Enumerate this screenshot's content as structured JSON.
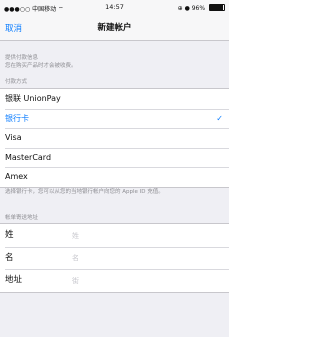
{
  "status_bar": {
    "carrier": "●●●○○ 中国移动 ⌔",
    "time": "14:57",
    "right_icons": "⊕ ●",
    "battery_text": "96%",
    "battery_level": 0.96
  },
  "nav": {
    "cancel_label": "取消",
    "title": "新建帐户"
  },
  "payment_info_note": {
    "line1": "提供付款信息",
    "line2": "您在购买产品时才会被收费。"
  },
  "payment_method": {
    "header": "付款方式",
    "options": [
      {
        "label": "银联 UnionPay",
        "selected": false
      },
      {
        "label": "银行卡",
        "selected": true
      },
      {
        "label": "Visa",
        "selected": false
      },
      {
        "label": "MasterCard",
        "selected": false
      },
      {
        "label": "Amex",
        "selected": false
      }
    ],
    "checkmark": "✓",
    "footer": "选择银行卡，您可以从您的当地银行帐户向您的 Apple ID 充值。"
  },
  "billing_address": {
    "header": "帐单寄送地址",
    "fields": [
      {
        "label": "姓",
        "placeholder": "姓"
      },
      {
        "label": "名",
        "placeholder": "名"
      },
      {
        "label": "地址",
        "placeholder": "街"
      }
    ]
  },
  "colors": {
    "accent": "#0a7cff",
    "background": "#efeff4",
    "secondary_text": "#8e8e93"
  }
}
